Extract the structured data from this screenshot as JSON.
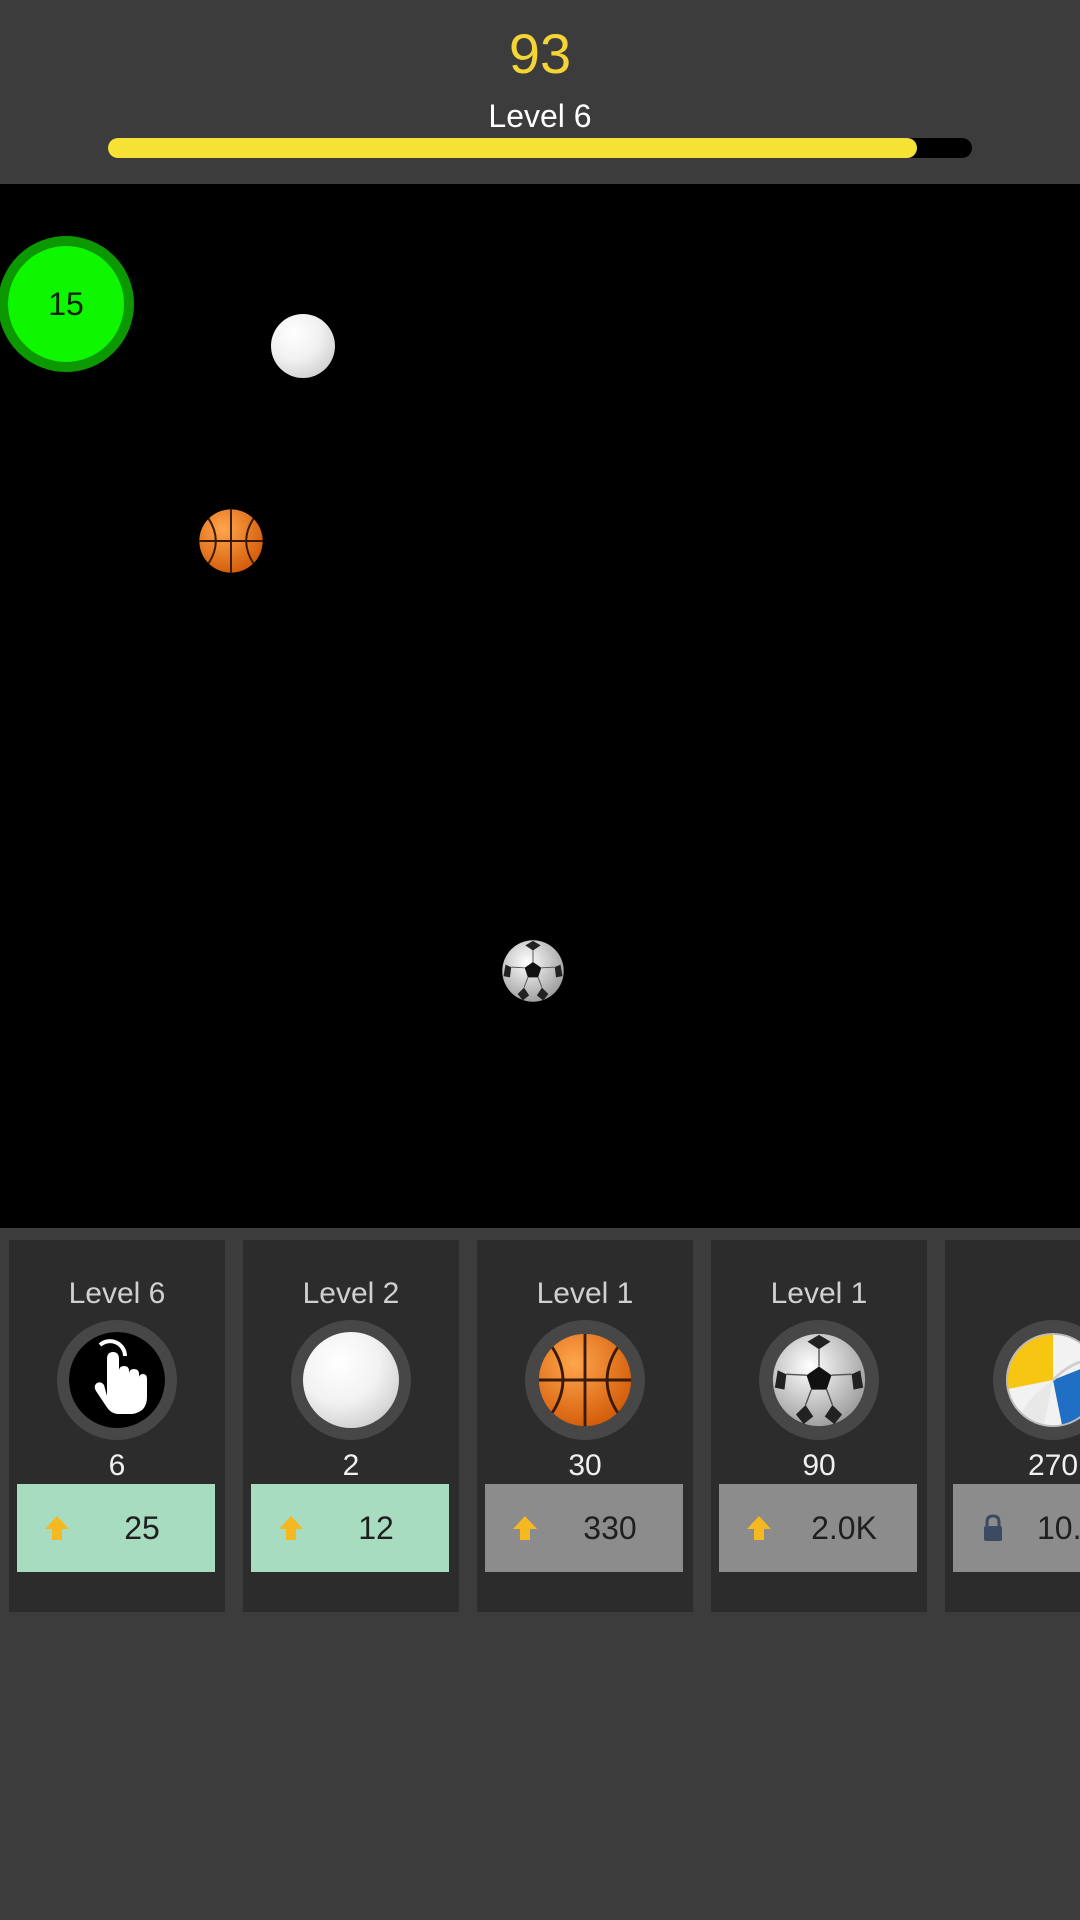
{
  "hud": {
    "score": "93",
    "level_label": "Level 6",
    "level_progress": 0.936
  },
  "field": {
    "bubble_value": "15"
  },
  "icons": {
    "white_ball": "white-ball-icon",
    "basketball": "basketball-icon",
    "soccer_ball": "soccer-ball-icon",
    "tap": "tap-hand-icon",
    "upgrade": "up-arrow-icon",
    "locked": "lock-icon",
    "volleyball": "volleyball-icon"
  },
  "colors": {
    "score_text": "#f5d536",
    "progress_fill": "#f5e234",
    "bubble_fill": "#0ff700",
    "bubble_ring": "#0b9800",
    "buy_affordable": "#a8dcc0",
    "buy_unaffordable": "#8c8c8c",
    "upgrade_arrow": "#f5b820"
  },
  "upgrades": [
    {
      "level": "Level 6",
      "power": "6",
      "cost": "25",
      "affordable": true,
      "locked": false
    },
    {
      "level": "Level 2",
      "power": "2",
      "cost": "12",
      "affordable": true,
      "locked": false
    },
    {
      "level": "Level 1",
      "power": "30",
      "cost": "330",
      "affordable": false,
      "locked": false
    },
    {
      "level": "Level 1",
      "power": "90",
      "cost": "2.0K",
      "affordable": false,
      "locked": false
    },
    {
      "level": "",
      "power": "270",
      "cost": "10.",
      "affordable": false,
      "locked": true
    }
  ]
}
